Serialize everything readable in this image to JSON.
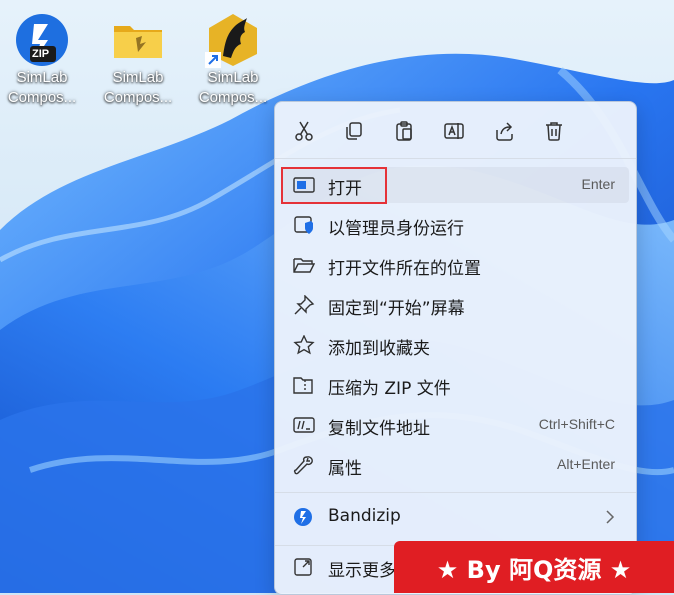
{
  "desktop": {
    "icons": [
      {
        "label_line1": "SimLab",
        "label_line2": "Compos...",
        "icon": "zip-file-icon",
        "badge": "ZIP"
      },
      {
        "label_line1": "SimLab",
        "label_line2": "Compos...",
        "icon": "folder-icon"
      },
      {
        "label_line1": "SimLab",
        "label_line2": "Compos...",
        "icon": "app-shortcut-icon"
      }
    ]
  },
  "context_menu": {
    "toolbar": [
      "cut-icon",
      "copy-icon",
      "paste-icon",
      "rename-icon",
      "share-icon",
      "delete-icon"
    ],
    "items": [
      {
        "label": "打开",
        "shortcut": "Enter",
        "icon": "open-window-icon"
      },
      {
        "label": "以管理员身份运行",
        "shortcut": "",
        "icon": "admin-shield-icon"
      },
      {
        "label": "打开文件所在的位置",
        "shortcut": "",
        "icon": "folder-open-icon"
      },
      {
        "label": "固定到“开始”屏幕",
        "shortcut": "",
        "icon": "pin-icon"
      },
      {
        "label": "添加到收藏夹",
        "shortcut": "",
        "icon": "star-icon"
      },
      {
        "label": "压缩为 ZIP 文件",
        "shortcut": "",
        "icon": "zip-compress-icon"
      },
      {
        "label": "复制文件地址",
        "shortcut": "Ctrl+Shift+C",
        "icon": "copy-path-icon"
      },
      {
        "label": "属性",
        "shortcut": "Alt+Enter",
        "icon": "wrench-icon"
      },
      {
        "label": "Bandizip",
        "shortcut": "",
        "icon": "bandizip-icon"
      },
      {
        "label": "显示更多",
        "shortcut": "",
        "icon": "more-options-icon"
      }
    ]
  },
  "watermark": {
    "text": "★ By 阿Q资源 ★"
  },
  "colors": {
    "accent": "#1f6fe6",
    "highlight_border": "#e53238",
    "watermark_bg": "#e01e23"
  }
}
